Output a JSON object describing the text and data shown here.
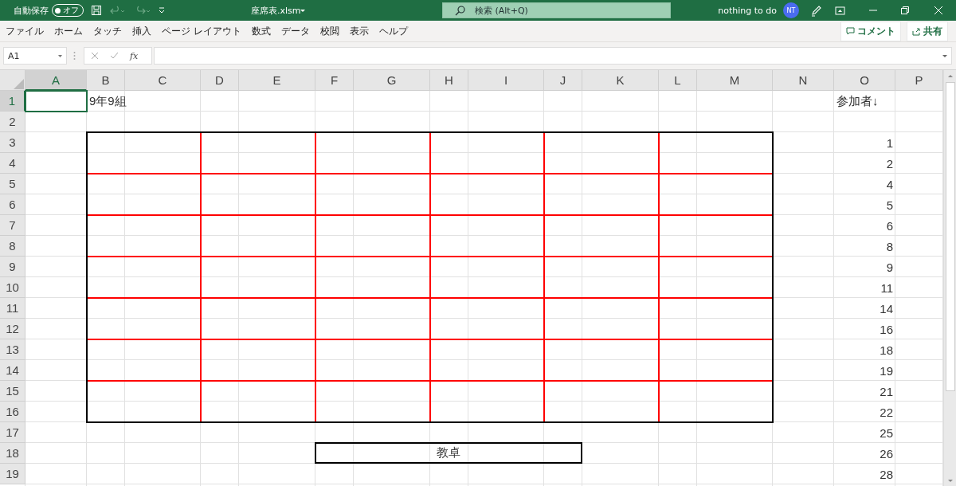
{
  "title_bar": {
    "autosave_label": "自動保存",
    "autosave_toggle": {
      "label": "オフ",
      "on": false
    },
    "file_name": "座席表.xlsm",
    "search": {
      "placeholder": "検索 (Alt+Q)"
    },
    "user_name": "nothing to do",
    "avatar": "NT"
  },
  "menu": [
    "ファイル",
    "ホーム",
    "タッチ",
    "挿入",
    "ページ レイアウト",
    "数式",
    "データ",
    "校閲",
    "表示",
    "ヘルプ"
  ],
  "actions": [
    "コメント",
    "共有"
  ],
  "formula_bar": {
    "name_box": "A1",
    "function_label": "fx"
  },
  "sheet": {
    "teacher_desk": {
      "label": "教卓"
    },
    "columns": [
      {
        "label": "A",
        "selected": true
      },
      {
        "label": "B",
        "selected": false
      },
      {
        "label": "C",
        "selected": false
      },
      {
        "label": "D",
        "selected": false
      },
      {
        "label": "E",
        "selected": false
      },
      {
        "label": "F",
        "selected": false
      },
      {
        "label": "G",
        "selected": false
      },
      {
        "label": "H",
        "selected": false
      },
      {
        "label": "I",
        "selected": false
      },
      {
        "label": "J",
        "selected": false
      },
      {
        "label": "K",
        "selected": false
      },
      {
        "label": "L",
        "selected": false
      },
      {
        "label": "M",
        "selected": false
      },
      {
        "label": "N",
        "selected": false
      },
      {
        "label": "O",
        "selected": false
      },
      {
        "label": "P",
        "selected": false
      }
    ],
    "rows": [
      {
        "label": "1",
        "selected": true,
        "cells": [
          "",
          "9年9組",
          "",
          "",
          "",
          "",
          "",
          "",
          "",
          "",
          "",
          "",
          "",
          "",
          "参加者↓"
        ]
      },
      {
        "label": "2",
        "selected": false,
        "cells": []
      },
      {
        "label": "3",
        "selected": false,
        "cells": [
          "",
          "",
          "",
          "",
          "",
          "",
          "",
          "",
          "",
          "",
          "",
          "",
          "",
          "",
          "1"
        ]
      },
      {
        "label": "4",
        "selected": false,
        "cells": [
          "",
          "",
          "",
          "",
          "",
          "",
          "",
          "",
          "",
          "",
          "",
          "",
          "",
          "",
          "2"
        ]
      },
      {
        "label": "5",
        "selected": false,
        "cells": [
          "",
          "",
          "",
          "",
          "",
          "",
          "",
          "",
          "",
          "",
          "",
          "",
          "",
          "",
          "4"
        ]
      },
      {
        "label": "6",
        "selected": false,
        "cells": [
          "",
          "",
          "",
          "",
          "",
          "",
          "",
          "",
          "",
          "",
          "",
          "",
          "",
          "",
          "5"
        ]
      },
      {
        "label": "7",
        "selected": false,
        "cells": [
          "",
          "",
          "",
          "",
          "",
          "",
          "",
          "",
          "",
          "",
          "",
          "",
          "",
          "",
          "6"
        ]
      },
      {
        "label": "8",
        "selected": false,
        "cells": [
          "",
          "",
          "",
          "",
          "",
          "",
          "",
          "",
          "",
          "",
          "",
          "",
          "",
          "",
          "8"
        ]
      },
      {
        "label": "9",
        "selected": false,
        "cells": [
          "",
          "",
          "",
          "",
          "",
          "",
          "",
          "",
          "",
          "",
          "",
          "",
          "",
          "",
          "9"
        ]
      },
      {
        "label": "10",
        "selected": false,
        "cells": [
          "",
          "",
          "",
          "",
          "",
          "",
          "",
          "",
          "",
          "",
          "",
          "",
          "",
          "",
          "11"
        ]
      },
      {
        "label": "11",
        "selected": false,
        "cells": [
          "",
          "",
          "",
          "",
          "",
          "",
          "",
          "",
          "",
          "",
          "",
          "",
          "",
          "",
          "14"
        ]
      },
      {
        "label": "12",
        "selected": false,
        "cells": [
          "",
          "",
          "",
          "",
          "",
          "",
          "",
          "",
          "",
          "",
          "",
          "",
          "",
          "",
          "16"
        ]
      },
      {
        "label": "13",
        "selected": false,
        "cells": [
          "",
          "",
          "",
          "",
          "",
          "",
          "",
          "",
          "",
          "",
          "",
          "",
          "",
          "",
          "18"
        ]
      },
      {
        "label": "14",
        "selected": false,
        "cells": [
          "",
          "",
          "",
          "",
          "",
          "",
          "",
          "",
          "",
          "",
          "",
          "",
          "",
          "",
          "19"
        ]
      },
      {
        "label": "15",
        "selected": false,
        "cells": [
          "",
          "",
          "",
          "",
          "",
          "",
          "",
          "",
          "",
          "",
          "",
          "",
          "",
          "",
          "21"
        ]
      },
      {
        "label": "16",
        "selected": false,
        "cells": [
          "",
          "",
          "",
          "",
          "",
          "",
          "",
          "",
          "",
          "",
          "",
          "",
          "",
          "",
          "22"
        ]
      },
      {
        "label": "17",
        "selected": false,
        "cells": [
          "",
          "",
          "",
          "",
          "",
          "",
          "",
          "",
          "",
          "",
          "",
          "",
          "",
          "",
          "25"
        ]
      },
      {
        "label": "18",
        "selected": false,
        "cells": [
          "",
          "",
          "",
          "",
          "",
          "",
          "",
          "",
          "",
          "",
          "",
          "",
          "",
          "",
          "26"
        ]
      },
      {
        "label": "19",
        "selected": false,
        "cells": [
          "",
          "",
          "",
          "",
          "",
          "",
          "",
          "",
          "",
          "",
          "",
          "",
          "",
          "",
          "28"
        ]
      }
    ]
  }
}
